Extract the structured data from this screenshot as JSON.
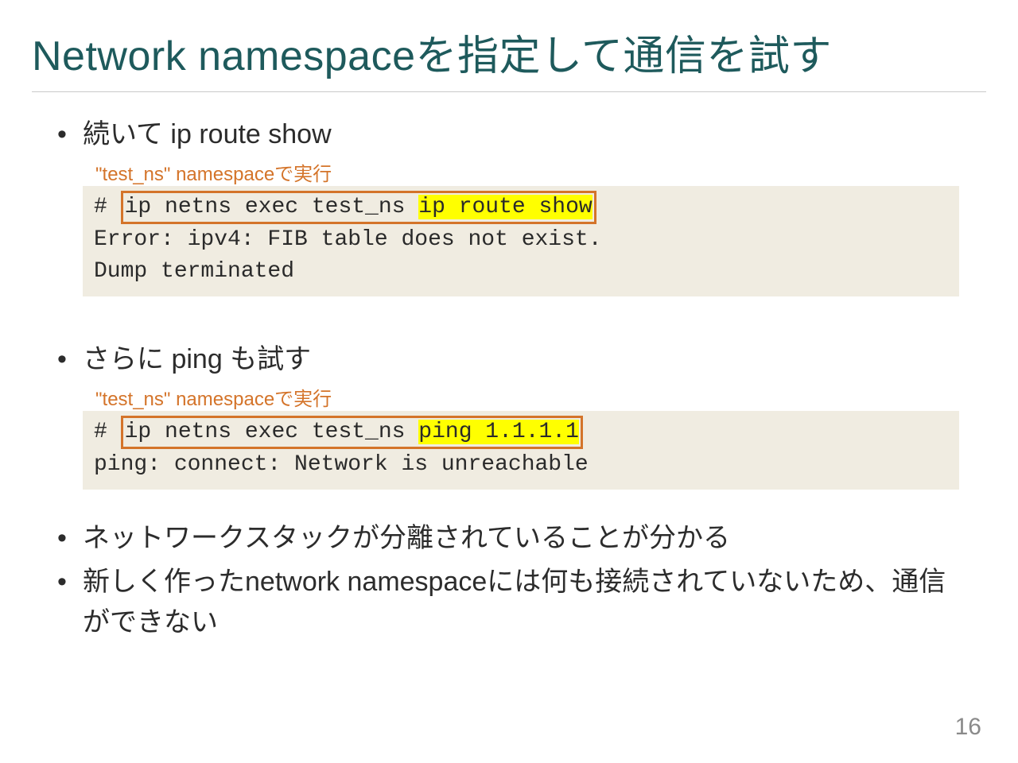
{
  "title": "Network namespaceを指定して通信を試す",
  "bullets": {
    "b1": "続いて ip route show",
    "b2": "さらに ping も試す",
    "b3": "ネットワークスタックが分離されていることが分かる",
    "b4": "新しく作ったnetwork namespaceには何も接続されていないため、通信ができない"
  },
  "annotation": {
    "a1": "\"test_ns\" namespaceで実行",
    "a2": "\"test_ns\" namespaceで実行"
  },
  "code1": {
    "prompt": "# ",
    "cmd_boxed": "ip netns exec test_ns ",
    "cmd_highlight": "ip route show",
    "out_line1": "Error: ipv4: FIB table does not exist.",
    "out_line2": "Dump terminated"
  },
  "code2": {
    "prompt": "# ",
    "cmd_boxed": "ip netns exec test_ns ",
    "cmd_highlight": "ping 1.1.1.1",
    "out_line1": "ping: connect: Network is unreachable"
  },
  "page_number": "16"
}
